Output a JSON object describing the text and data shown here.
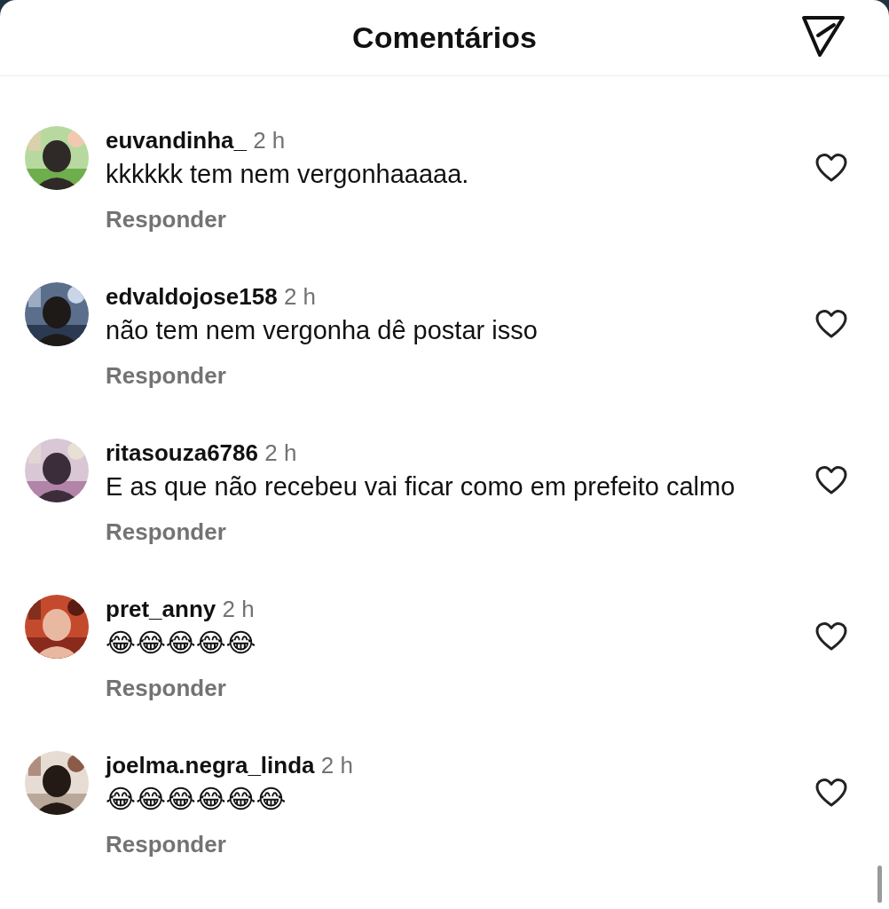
{
  "header": {
    "title": "Comentários"
  },
  "comments": [
    {
      "username": "euvandinha_",
      "time": "2 h",
      "text": "kkkkkk tem nem vergonhaaaaa.",
      "reply": "Responder",
      "liked": false
    },
    {
      "username": "edvaldojose158",
      "time": "2 h",
      "text": "não tem nem vergonha dê postar isso",
      "reply": "Responder",
      "liked": false
    },
    {
      "username": "ritasouza6786",
      "time": "2 h",
      "text": "E as que não recebeu vai ficar como em prefeito calmo",
      "reply": "Responder",
      "liked": false
    },
    {
      "username": "pret_anny",
      "time": "2 h",
      "text": "😂😂😂😂😂",
      "reply": "Responder",
      "liked": false
    },
    {
      "username": "joelma.negra_linda",
      "time": "2 h",
      "text": "😂😂😂😂😂😂",
      "reply": "Responder",
      "liked": false
    }
  ]
}
